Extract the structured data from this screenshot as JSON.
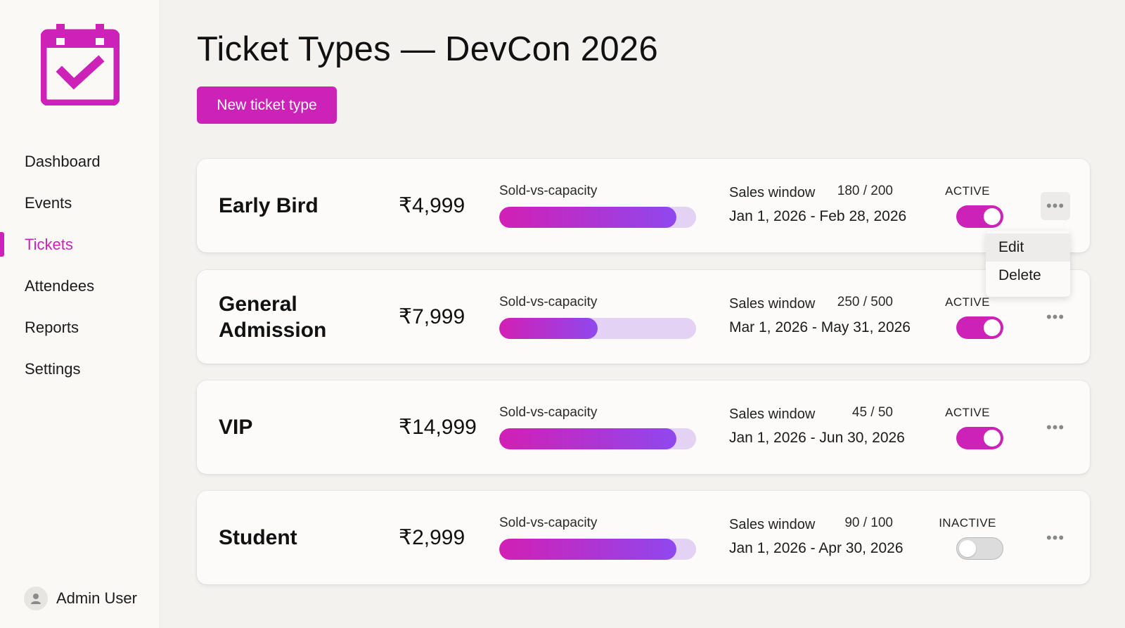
{
  "sidebar": {
    "logo_icon": "calendar-check-icon",
    "items": [
      {
        "label": "Dashboard",
        "active": false
      },
      {
        "label": "Events",
        "active": false
      },
      {
        "label": "Tickets",
        "active": true
      },
      {
        "label": "Attendees",
        "active": false
      },
      {
        "label": "Reports",
        "active": false
      },
      {
        "label": "Settings",
        "active": false
      }
    ],
    "user": {
      "name": "Admin User",
      "icon": "user-icon"
    }
  },
  "header": {
    "title": "Ticket Types — DevCon 2026",
    "new_button_label": "New ticket type"
  },
  "tickets": [
    {
      "name": "Early Bird",
      "price": "₹4,999",
      "capacity_label": "Sold-vs-capacity",
      "sold_text": "180 / 200",
      "sold": 180,
      "capacity": 200,
      "window_label": "Sales window",
      "window": "Jan 1, 2026 - Feb 28, 2026",
      "status": "ACTIVE",
      "active": true
    },
    {
      "name": "General Admission",
      "price": "₹7,999",
      "capacity_label": "Sold-vs-capacity",
      "sold_text": "250 / 500",
      "sold": 250,
      "capacity": 500,
      "window_label": "Sales window",
      "window": "Mar 1, 2026 - May 31, 2026",
      "status": "ACTIVE",
      "active": true
    },
    {
      "name": "VIP",
      "price": "₹14,999",
      "capacity_label": "Sold-vs-capacity",
      "sold_text": "45 / 50",
      "sold": 45,
      "capacity": 50,
      "window_label": "Sales window",
      "window": "Jan 1, 2026 - Jun 30, 2026",
      "status": "ACTIVE",
      "active": true
    },
    {
      "name": "Student",
      "price": "₹2,999",
      "capacity_label": "Sold-vs-capacity",
      "sold_text": "90 / 100",
      "sold": 90,
      "capacity": 100,
      "window_label": "Sales window",
      "window": "Jan 1, 2026 - Apr 30, 2026",
      "status": "INACTIVE",
      "active": false
    }
  ],
  "row_menu": {
    "items": [
      {
        "label": "Edit"
      },
      {
        "label": "Delete"
      }
    ]
  },
  "colors": {
    "accent": "#cc22b8",
    "progress_start": "#d21fb4",
    "progress_end": "#8f48ee",
    "progress_track": "#e4d2f5"
  }
}
